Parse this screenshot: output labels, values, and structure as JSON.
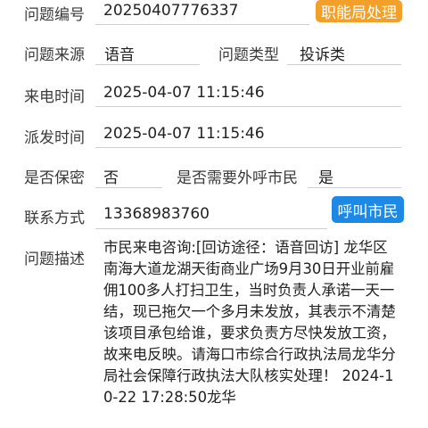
{
  "form": {
    "problem_no": {
      "label": "问题编号",
      "value": "20250407776337"
    },
    "dispatch_button": "职能局处理",
    "problem_source": {
      "label": "问题来源",
      "value": "语音"
    },
    "problem_type": {
      "label": "问题类型",
      "value": "投诉类"
    },
    "call_time": {
      "label": "来电时间",
      "value": "2025-04-07 11:15:46"
    },
    "dispatch_time": {
      "label": "派发时间",
      "value": "2025-04-07 11:15:46"
    },
    "confidential": {
      "label": "是否保密",
      "value": "否"
    },
    "callback_needed": {
      "label": "是否需要外呼市民",
      "value": "是"
    },
    "contact": {
      "label": "联系方式",
      "value": "13368983760"
    },
    "call_button": "呼叫市民",
    "description": {
      "label": "问题描述",
      "text": "市民来电咨询:[回访途径：语音回访] 龙华区南海大道龙湖天街商业广场9月30日开业前雇佣100多人打扫卫生，当时负责人承诺一天一结，现已拖欠一个多月未发放，其表示不清楚该项目承包给谁，要求负责方尽快发放工资，故来电反映。请海口市综合行政执法局龙华分局社会保障行政执法大队核实处理！ 2024-10-22 17:28:50龙华"
    }
  }
}
